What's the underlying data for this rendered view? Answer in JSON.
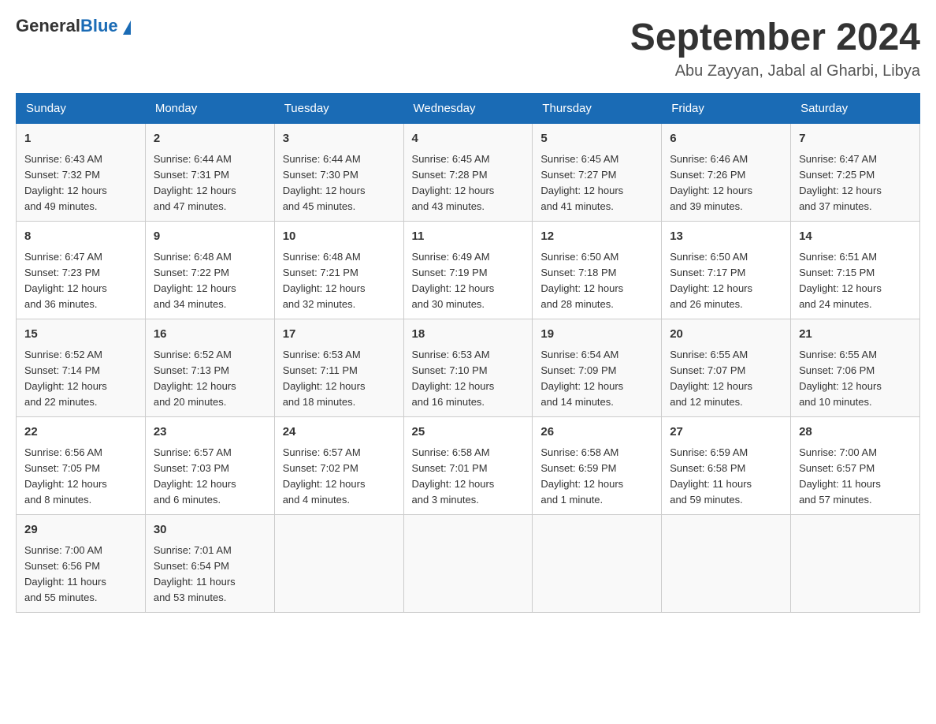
{
  "header": {
    "logo": {
      "text_general": "General",
      "text_blue": "Blue"
    },
    "title": "September 2024",
    "location": "Abu Zayyan, Jabal al Gharbi, Libya"
  },
  "days_of_week": [
    "Sunday",
    "Monday",
    "Tuesday",
    "Wednesday",
    "Thursday",
    "Friday",
    "Saturday"
  ],
  "weeks": [
    [
      {
        "day": "1",
        "sunrise": "6:43 AM",
        "sunset": "7:32 PM",
        "daylight": "12 hours and 49 minutes."
      },
      {
        "day": "2",
        "sunrise": "6:44 AM",
        "sunset": "7:31 PM",
        "daylight": "12 hours and 47 minutes."
      },
      {
        "day": "3",
        "sunrise": "6:44 AM",
        "sunset": "7:30 PM",
        "daylight": "12 hours and 45 minutes."
      },
      {
        "day": "4",
        "sunrise": "6:45 AM",
        "sunset": "7:28 PM",
        "daylight": "12 hours and 43 minutes."
      },
      {
        "day": "5",
        "sunrise": "6:45 AM",
        "sunset": "7:27 PM",
        "daylight": "12 hours and 41 minutes."
      },
      {
        "day": "6",
        "sunrise": "6:46 AM",
        "sunset": "7:26 PM",
        "daylight": "12 hours and 39 minutes."
      },
      {
        "day": "7",
        "sunrise": "6:47 AM",
        "sunset": "7:25 PM",
        "daylight": "12 hours and 37 minutes."
      }
    ],
    [
      {
        "day": "8",
        "sunrise": "6:47 AM",
        "sunset": "7:23 PM",
        "daylight": "12 hours and 36 minutes."
      },
      {
        "day": "9",
        "sunrise": "6:48 AM",
        "sunset": "7:22 PM",
        "daylight": "12 hours and 34 minutes."
      },
      {
        "day": "10",
        "sunrise": "6:48 AM",
        "sunset": "7:21 PM",
        "daylight": "12 hours and 32 minutes."
      },
      {
        "day": "11",
        "sunrise": "6:49 AM",
        "sunset": "7:19 PM",
        "daylight": "12 hours and 30 minutes."
      },
      {
        "day": "12",
        "sunrise": "6:50 AM",
        "sunset": "7:18 PM",
        "daylight": "12 hours and 28 minutes."
      },
      {
        "day": "13",
        "sunrise": "6:50 AM",
        "sunset": "7:17 PM",
        "daylight": "12 hours and 26 minutes."
      },
      {
        "day": "14",
        "sunrise": "6:51 AM",
        "sunset": "7:15 PM",
        "daylight": "12 hours and 24 minutes."
      }
    ],
    [
      {
        "day": "15",
        "sunrise": "6:52 AM",
        "sunset": "7:14 PM",
        "daylight": "12 hours and 22 minutes."
      },
      {
        "day": "16",
        "sunrise": "6:52 AM",
        "sunset": "7:13 PM",
        "daylight": "12 hours and 20 minutes."
      },
      {
        "day": "17",
        "sunrise": "6:53 AM",
        "sunset": "7:11 PM",
        "daylight": "12 hours and 18 minutes."
      },
      {
        "day": "18",
        "sunrise": "6:53 AM",
        "sunset": "7:10 PM",
        "daylight": "12 hours and 16 minutes."
      },
      {
        "day": "19",
        "sunrise": "6:54 AM",
        "sunset": "7:09 PM",
        "daylight": "12 hours and 14 minutes."
      },
      {
        "day": "20",
        "sunrise": "6:55 AM",
        "sunset": "7:07 PM",
        "daylight": "12 hours and 12 minutes."
      },
      {
        "day": "21",
        "sunrise": "6:55 AM",
        "sunset": "7:06 PM",
        "daylight": "12 hours and 10 minutes."
      }
    ],
    [
      {
        "day": "22",
        "sunrise": "6:56 AM",
        "sunset": "7:05 PM",
        "daylight": "12 hours and 8 minutes."
      },
      {
        "day": "23",
        "sunrise": "6:57 AM",
        "sunset": "7:03 PM",
        "daylight": "12 hours and 6 minutes."
      },
      {
        "day": "24",
        "sunrise": "6:57 AM",
        "sunset": "7:02 PM",
        "daylight": "12 hours and 4 minutes."
      },
      {
        "day": "25",
        "sunrise": "6:58 AM",
        "sunset": "7:01 PM",
        "daylight": "12 hours and 3 minutes."
      },
      {
        "day": "26",
        "sunrise": "6:58 AM",
        "sunset": "6:59 PM",
        "daylight": "12 hours and 1 minute."
      },
      {
        "day": "27",
        "sunrise": "6:59 AM",
        "sunset": "6:58 PM",
        "daylight": "11 hours and 59 minutes."
      },
      {
        "day": "28",
        "sunrise": "7:00 AM",
        "sunset": "6:57 PM",
        "daylight": "11 hours and 57 minutes."
      }
    ],
    [
      {
        "day": "29",
        "sunrise": "7:00 AM",
        "sunset": "6:56 PM",
        "daylight": "11 hours and 55 minutes."
      },
      {
        "day": "30",
        "sunrise": "7:01 AM",
        "sunset": "6:54 PM",
        "daylight": "11 hours and 53 minutes."
      },
      null,
      null,
      null,
      null,
      null
    ]
  ],
  "labels": {
    "sunrise": "Sunrise:",
    "sunset": "Sunset:",
    "daylight": "Daylight:"
  }
}
